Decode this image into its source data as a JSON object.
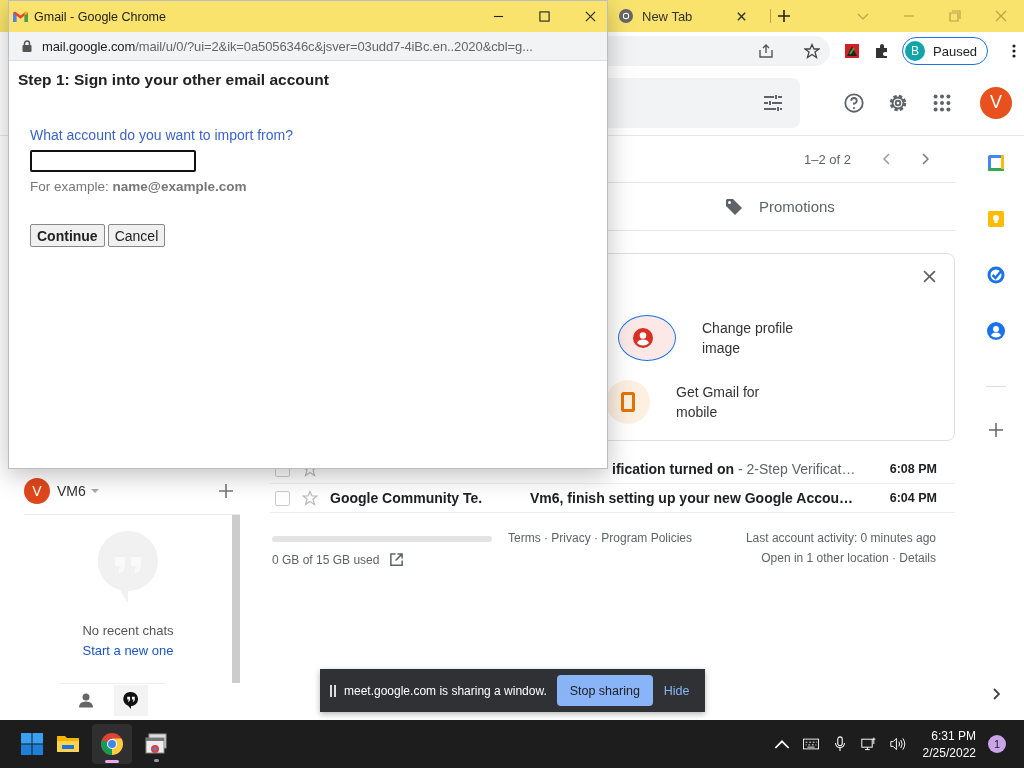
{
  "browser": {
    "tabs": [
      {
        "label": "New Tab",
        "selected": false
      }
    ],
    "profile": {
      "initial": "B",
      "label": "Paused"
    }
  },
  "gmail": {
    "avatar": "V",
    "pagination": "1–2 of 2",
    "category_tab": "Promotions",
    "tips": [
      {
        "kind": "profile",
        "label": "Change profile image"
      },
      {
        "kind": "mobile",
        "label": "Get Gmail for mobile"
      }
    ],
    "emails": [
      {
        "subject": "ification turned on",
        "snippet": " - 2-Step Verificat…",
        "time": "6:08 PM",
        "unread": true,
        "checked": false
      },
      {
        "sender": "Google Community Te.",
        "subject": "Vm6, finish setting up your new Google Accou…",
        "time": "6:04 PM",
        "unread": true,
        "checked": false
      }
    ],
    "storage": {
      "text": "0 GB of 15 GB used",
      "level": 0
    },
    "footer_links": "Terms · Privacy · Program Policies",
    "activity": "Last account activity: 0 minutes ago",
    "other_location": "Open in 1 other location · Details"
  },
  "hangouts": {
    "user_initial": "V",
    "user": "VM6",
    "empty": "No recent chats",
    "start_link": "Start a new one"
  },
  "popup": {
    "title": "Gmail - Google Chrome",
    "url": {
      "host": "mail.google.com",
      "path": "/mail/u/0/?ui=2&ik=0a5056346c&jsver=03udd7-4iBc.en..2020&cbl=g..."
    },
    "heading": "Step 1: Sign into your other email account",
    "question": "What account do you want to import from?",
    "hint": "For example: **name@example.com**",
    "buttons": [
      {
        "label": "Continue",
        "primary": true
      },
      {
        "label": "Cancel",
        "primary": false
      }
    ]
  },
  "share_bar": {
    "message": "meet.google.com is sharing a window.",
    "stop": "Stop sharing",
    "hide": "Hide"
  },
  "taskbar": {
    "apps": [
      {
        "kind": "explorer",
        "selected": false,
        "running": false
      },
      {
        "kind": "chrome",
        "selected": true,
        "running": true
      },
      {
        "kind": "window",
        "selected": false,
        "running": true
      }
    ],
    "time": "6:31 PM",
    "date": "2/25/2022",
    "notifications": "1"
  }
}
